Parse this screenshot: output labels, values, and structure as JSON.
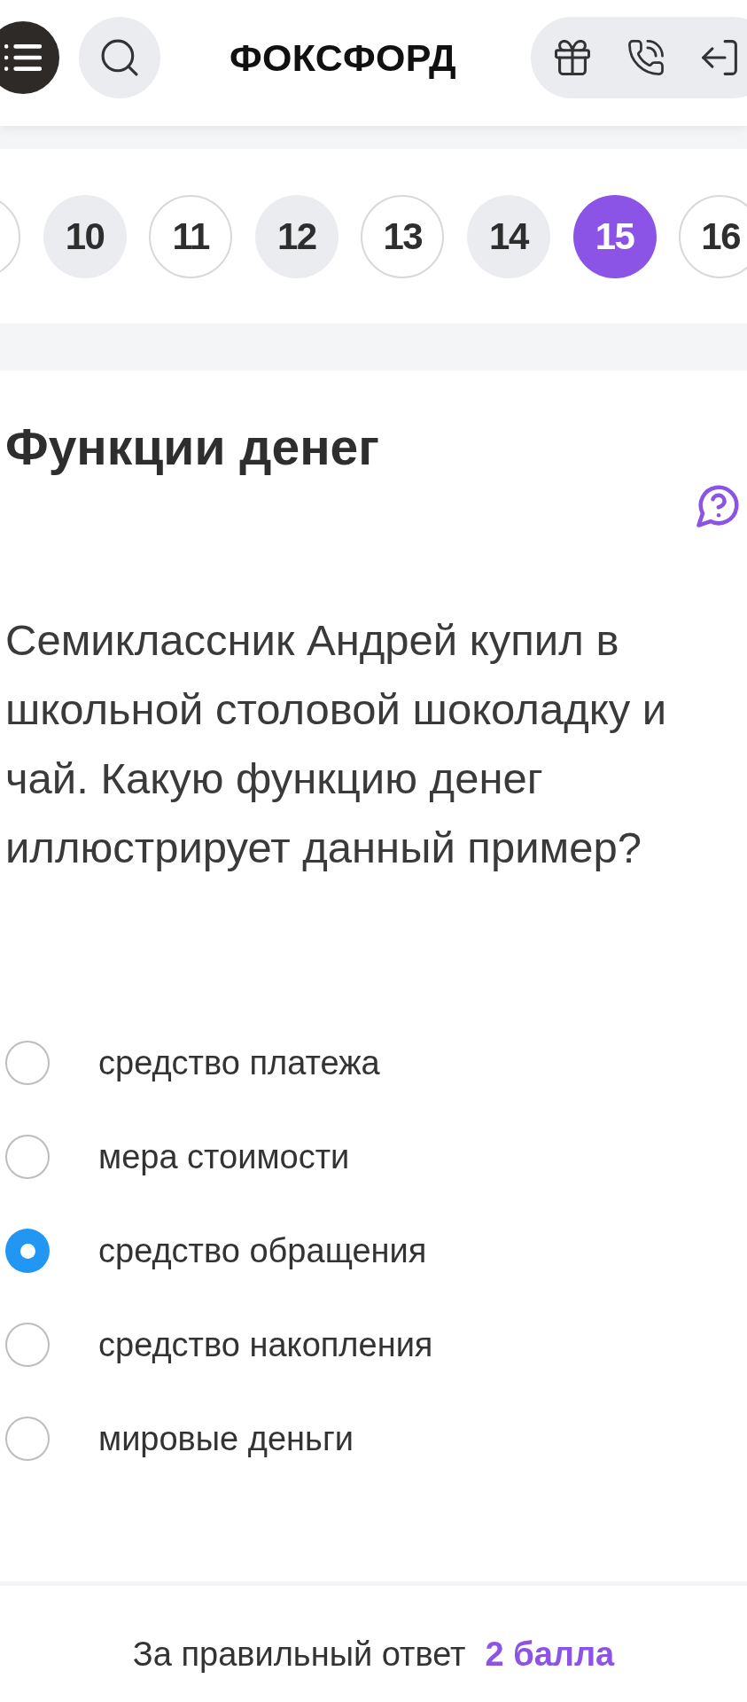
{
  "header": {
    "logo": "ФОКСФОРД"
  },
  "question_nav": {
    "steps": [
      {
        "answered": false,
        "selected": false
      },
      {
        "label": "10",
        "answered": true,
        "selected": false
      },
      {
        "label": "11",
        "answered": false,
        "selected": false
      },
      {
        "label": "12",
        "answered": true,
        "selected": false
      },
      {
        "label": "13",
        "answered": false,
        "selected": false
      },
      {
        "label": "14",
        "answered": true,
        "selected": false
      },
      {
        "label": "15",
        "answered": false,
        "selected": true
      },
      {
        "label": "16",
        "answered": false,
        "selected": false
      }
    ]
  },
  "task": {
    "title": "Функции денег",
    "question": "Семиклассник Андрей купил в школьной столовой шоколадку и чай. Какую функцию денег иллюстрирует данный пример?",
    "options": [
      {
        "label": "средство платежа",
        "selected": false
      },
      {
        "label": "мера стоимости",
        "selected": false
      },
      {
        "label": "средство обращения",
        "selected": true
      },
      {
        "label": "средство накопления",
        "selected": false
      },
      {
        "label": "мировые деньги",
        "selected": false
      }
    ]
  },
  "footer": {
    "label": "За правильный ответ",
    "points": "2 балла"
  }
}
